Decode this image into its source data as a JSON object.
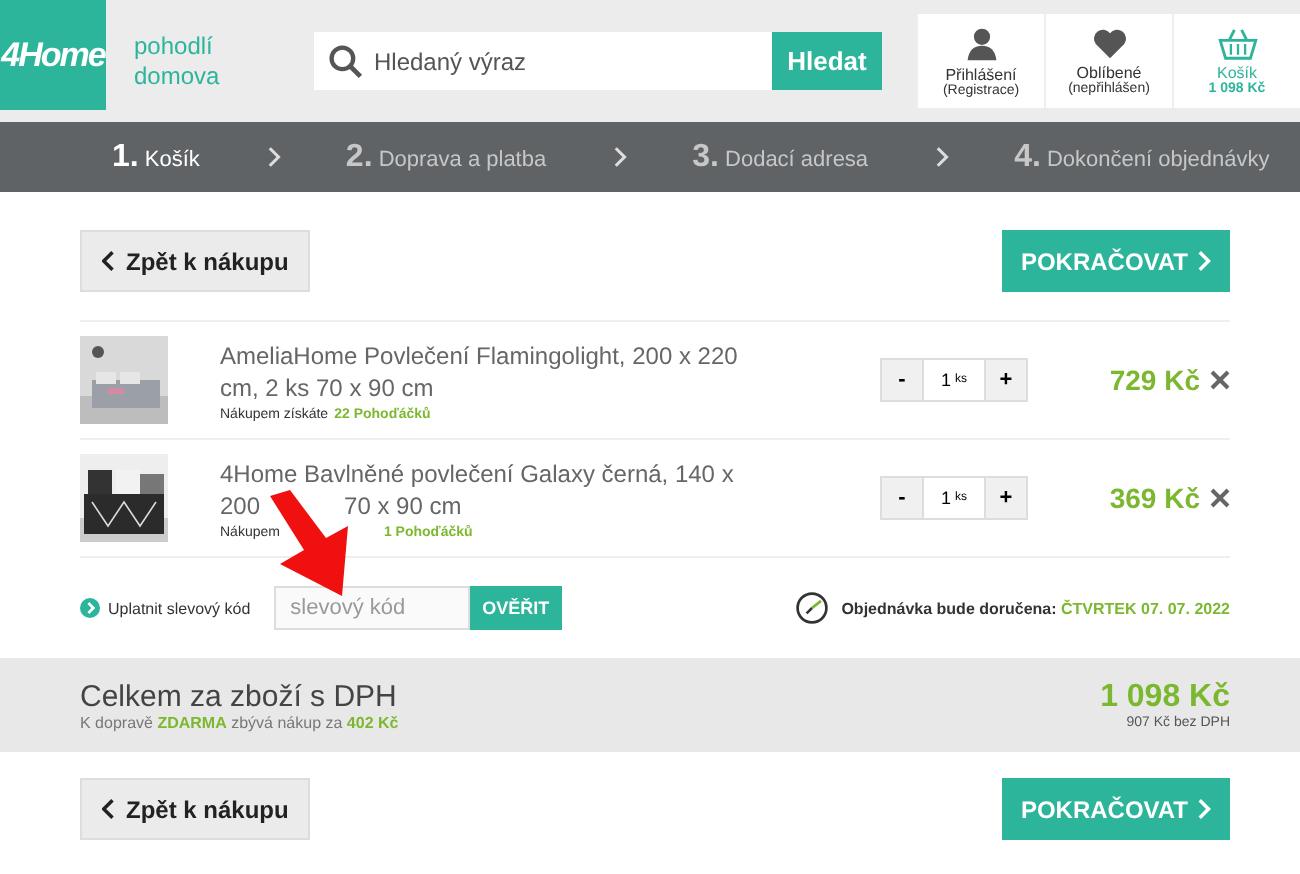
{
  "header": {
    "logo": "4Home",
    "tagline": "pohodlí domova",
    "search": {
      "placeholder": "Hledaný výraz",
      "button": "Hledat"
    },
    "account": [
      {
        "kind": "user",
        "label": "Přihlášení",
        "sub": "(Registrace)"
      },
      {
        "kind": "heart",
        "label": "Oblíbené",
        "sub": "(nepřihlášen)"
      },
      {
        "kind": "basket",
        "label": "Košík",
        "sub": "1 098 Kč"
      }
    ]
  },
  "steps": [
    {
      "number": "1.",
      "label": "Košík",
      "selected": true
    },
    {
      "number": "2.",
      "label": "Doprava a platba",
      "selected": false
    },
    {
      "number": "3.",
      "label": "Dodací adresa",
      "selected": false
    },
    {
      "number": "4.",
      "label": "Dokončení objednávky",
      "selected": false
    }
  ],
  "back_button": "Zpět k nákupu",
  "continue_button": "POKRAČOVAT",
  "items": [
    {
      "name_lines": [
        [
          "AmeliaHome Povlečení Flamingolight, 200 x 220"
        ],
        [
          "cm, 2 ks 70 x 90 cm"
        ]
      ],
      "points_text": "Nákupem získáte",
      "points": "22 Pohoďáčků",
      "decrease": "-",
      "quantity": "1",
      "unit": "ks",
      "increase": "+",
      "price": "729 Kč"
    },
    {
      "name_lines": [
        [
          "4Home Bavlněné povlečení Galaxy černá, 140 x"
        ],
        [
          "200",
          "70 x 90 cm"
        ]
      ],
      "points_text": "Nákupem",
      "points": "1 Pohoďáčků",
      "decrease": "-",
      "quantity": "1",
      "unit": "ks",
      "increase": "+",
      "price": "369 Kč"
    }
  ],
  "discount": {
    "label": "Uplatnit slevový kód",
    "placeholder": "slevový kód",
    "button": "OVĚŘIT"
  },
  "delivery": {
    "label": "Objednávka bude doručena:",
    "date": "ČTVRTEK 07. 07. 2022"
  },
  "total": {
    "label": "Celkem za zboží s DPH",
    "note": "K dopravě **ZDARMA** zbývá nákup za **402 Kč**",
    "price": "1 098 Kč",
    "price_no_vat": "907 Kč bez DPH"
  },
  "bottom_back_button": "Zpět k nákupu",
  "bottom_continue_button": "POKRAČOVAT"
}
